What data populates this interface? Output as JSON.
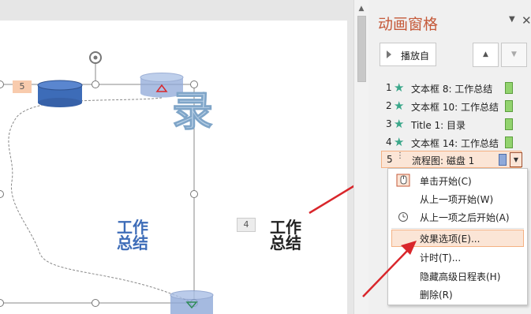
{
  "slide": {
    "title_glyph": "录",
    "left_label": "工作\n总结",
    "right_label": "工作\n总结",
    "tag_five": "5",
    "tag_four": "4"
  },
  "pane": {
    "title": "动画窗格",
    "menu_icon": "dropdown-triangle",
    "close": "✕",
    "play_label": "播放自",
    "up": "▲",
    "down": "▼"
  },
  "animations": [
    {
      "num": "1",
      "text": "文本框 8: 工作总结",
      "icon": "star"
    },
    {
      "num": "2",
      "text": "文本框 10: 工作总结",
      "icon": "star"
    },
    {
      "num": "3",
      "text": "Title 1:  目录",
      "icon": "star"
    },
    {
      "num": "4",
      "text": "文本框 14: 工作总结",
      "icon": "star"
    },
    {
      "num": "5",
      "text": "流程图: 磁盘 1",
      "icon": "motion-path"
    }
  ],
  "context_menu": [
    {
      "label": "单击开始(C)",
      "icon": "mouse-click"
    },
    {
      "label": "从上一项开始(W)",
      "icon": ""
    },
    {
      "label": "从上一项之后开始(A)",
      "icon": "clock"
    },
    {
      "label": "效果选项(E)...",
      "icon": ""
    },
    {
      "label": "计时(T)...",
      "icon": ""
    },
    {
      "label": "隐藏高级日程表(H)",
      "icon": ""
    },
    {
      "label": "删除(R)",
      "icon": ""
    }
  ],
  "colors": {
    "accent": "#c55a3a",
    "star": "#3aa78a",
    "highlight": "#fbe5d6",
    "arrow": "#d9262b",
    "cylinder": "#3d6cb8"
  }
}
